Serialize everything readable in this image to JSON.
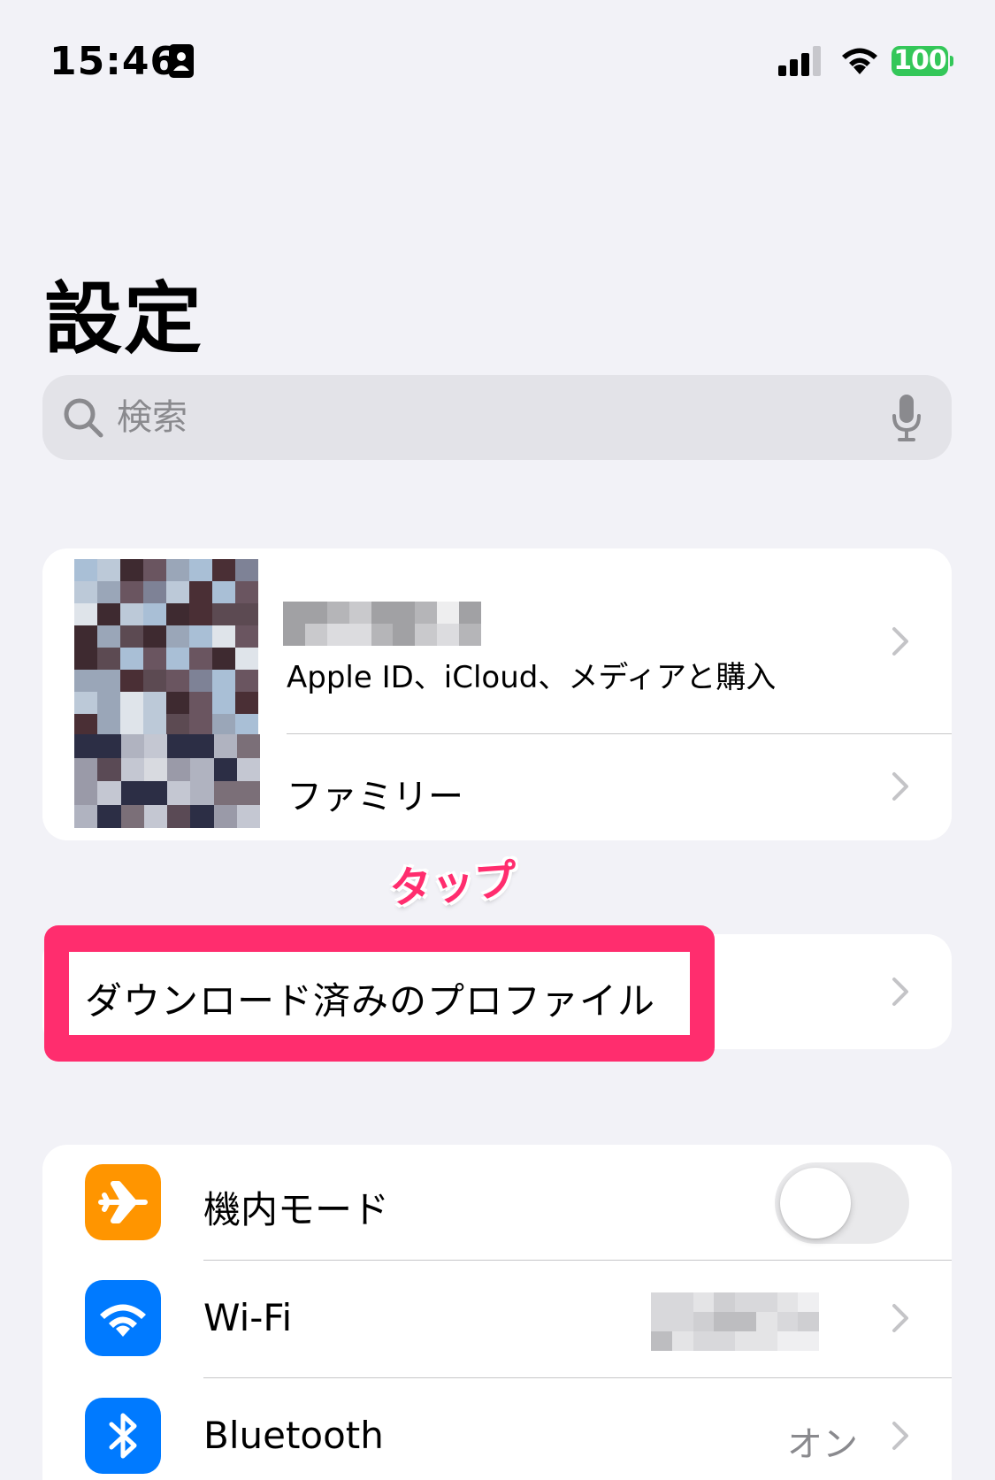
{
  "status_bar": {
    "time": "15:46",
    "battery": "100",
    "icons": [
      "person-card-icon",
      "signal-icon",
      "wifi-icon",
      "battery-icon"
    ]
  },
  "header": {
    "title": "設定"
  },
  "search": {
    "placeholder": "検索"
  },
  "account": {
    "subtitle": "Apple ID、iCloud、メディアと購入",
    "family_label": "ファミリー"
  },
  "annotation": {
    "tap_label": "タップ"
  },
  "profiles": {
    "label": "ダウンロード済みのプロファイル"
  },
  "settings": {
    "items": [
      {
        "label": "機内モード",
        "icon": "airplane-icon",
        "color": "#ff9500",
        "toggle": false
      },
      {
        "label": "Wi-Fi",
        "icon": "wifi-icon",
        "color": "#007aff",
        "value": ""
      },
      {
        "label": "Bluetooth",
        "icon": "bluetooth-icon",
        "color": "#007aff",
        "value": "オン"
      }
    ]
  },
  "colors": {
    "background": "#f2f2f7",
    "highlight": "#ff2d6e",
    "battery": "#34c759"
  }
}
